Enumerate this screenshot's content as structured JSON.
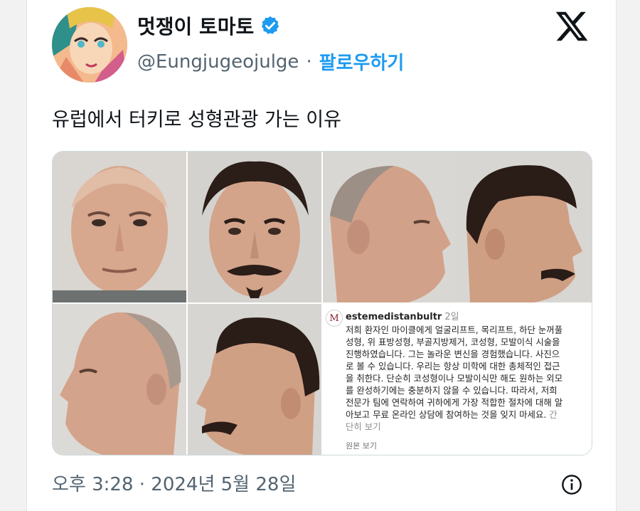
{
  "tweet": {
    "display_name": "멋쟁이 토마토",
    "handle": "@Eungjugeojulge",
    "separator": "·",
    "follow_label": "팔로우하기",
    "text": "유럽에서 터키로 성형관광 가는 이유",
    "timestamp": "오후 3:28 · 2024년 5월 28일"
  },
  "icons": {
    "verified": "verified-badge-icon",
    "x_logo": "x-logo-icon",
    "info": "info-icon"
  },
  "colors": {
    "accent": "#1d9bf0",
    "text_primary": "#0f1419",
    "text_secondary": "#536471"
  },
  "instagram_post": {
    "username": "estemedistanbultr",
    "time_ago": "2일",
    "lines": [
      "저희 환자인 마이클에게 얼굴리프트, 목리프트, 하단 눈꺼풀",
      "성형, 위 표방성형, 부골지방제거, 코성형, 모발이식 시술을",
      "진행하였습니다. 그는 놀라운 변신을 경험했습니다. 사진으",
      "로 볼 수 있습니다. 우리는 항상 미학에 대한 총체적인 접근",
      "을 취한다. 단순히 코성형이나 모발이식만 해도 원하는 외모",
      "를 완성하기에는 충분하지 않을 수 있습니다. 따라서, 저희",
      "전문가 팀에 연락하여 귀하에게 가장 적합한 절차에 대해 알",
      "아보고 무료 온라인 상담에 참여하는 것을 잊지 마세요."
    ],
    "line_tail": "간",
    "line_last": "단히 보기",
    "original_label": "원본 보기"
  }
}
